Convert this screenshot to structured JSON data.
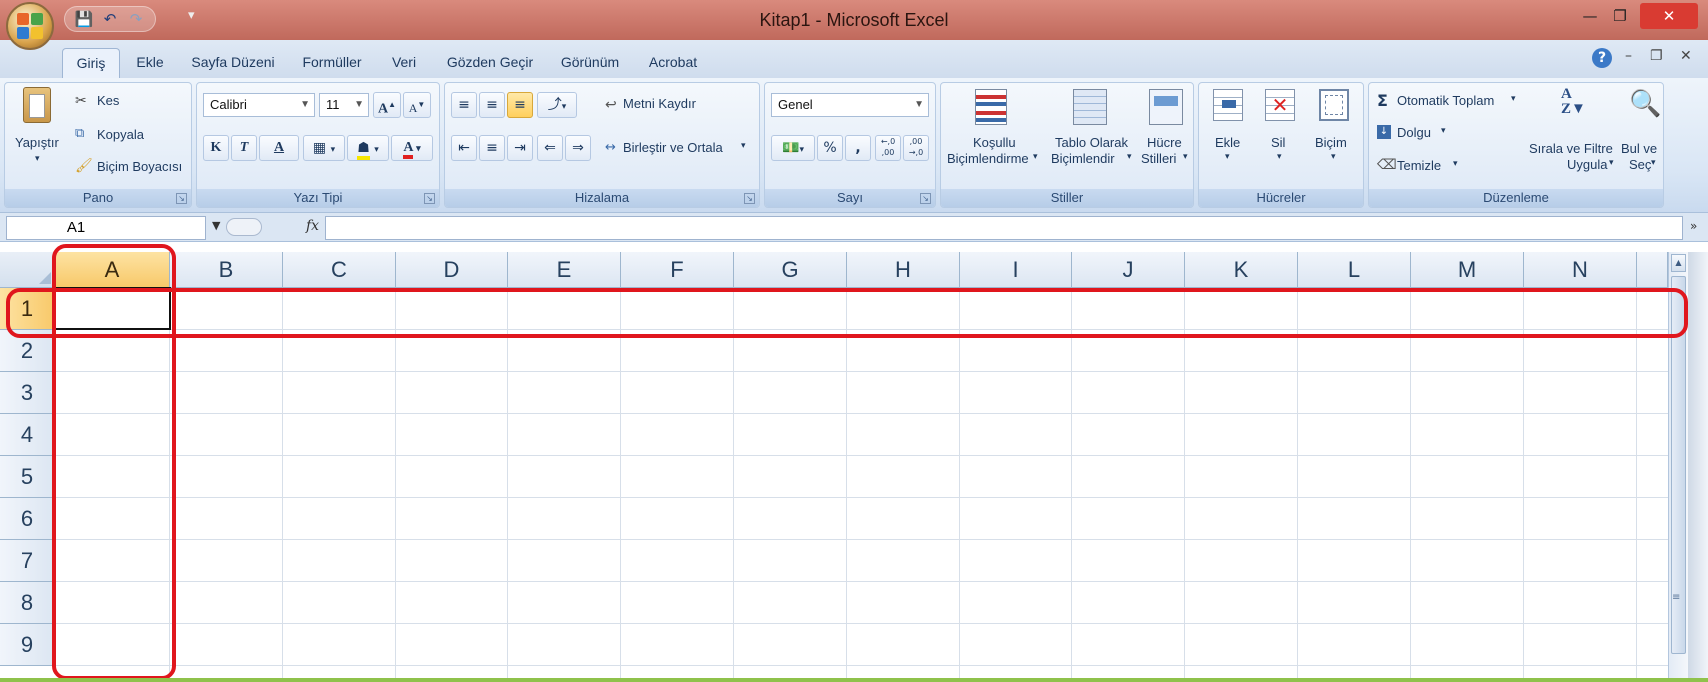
{
  "window": {
    "title": "Kitap1 - Microsoft Excel"
  },
  "tabs": [
    "Giriş",
    "Ekle",
    "Sayfa Düzeni",
    "Formüller",
    "Veri",
    "Gözden Geçir",
    "Görünüm",
    "Acrobat"
  ],
  "ribbon": {
    "clipboard": {
      "paste": "Yapıştır",
      "cut": "Kes",
      "copy": "Kopyala",
      "format_painter": "Biçim Boyacısı",
      "label": "Pano"
    },
    "font": {
      "name": "Calibri",
      "size": "11",
      "bold": "K",
      "italic": "T",
      "underline": "A",
      "label": "Yazı Tipi"
    },
    "alignment": {
      "wrap": "Metni Kaydır",
      "merge": "Birleştir ve Ortala",
      "label": "Hizalama"
    },
    "number": {
      "format": "Genel",
      "percent": "%",
      "comma": ",",
      "inc_decimal": "←,0 ,00",
      "dec_decimal": ",00 →,0",
      "label": "Sayı"
    },
    "styles": {
      "cond_1": "Koşullu",
      "cond_2": "Biçimlendirme",
      "table_1": "Tablo Olarak",
      "table_2": "Biçimlendir",
      "cell_1": "Hücre",
      "cell_2": "Stilleri",
      "label": "Stiller"
    },
    "cells": {
      "insert": "Ekle",
      "delete": "Sil",
      "format": "Biçim",
      "label": "Hücreler"
    },
    "editing": {
      "autosum": "Otomatik Toplam",
      "fill": "Dolgu",
      "clear": "Temizle",
      "sort_1": "Sırala ve Filtre",
      "sort_2": "Uygula",
      "find_1": "Bul ve",
      "find_2": "Seç",
      "label": "Düzenleme"
    }
  },
  "formula_bar": {
    "name_box": "A1",
    "fx": "fx"
  },
  "sheet": {
    "columns": [
      "A",
      "B",
      "C",
      "D",
      "E",
      "F",
      "G",
      "H",
      "I",
      "J",
      "K",
      "L",
      "M",
      "N"
    ],
    "rows": [
      "1",
      "2",
      "3",
      "4",
      "5",
      "6",
      "7",
      "8",
      "9"
    ],
    "selected_cell": "A1"
  },
  "colors": {
    "title_bar": "#c76b5e",
    "selection_header": "#f8c96a",
    "highlight_box": "#e0161d",
    "close_button": "#d93b32"
  }
}
